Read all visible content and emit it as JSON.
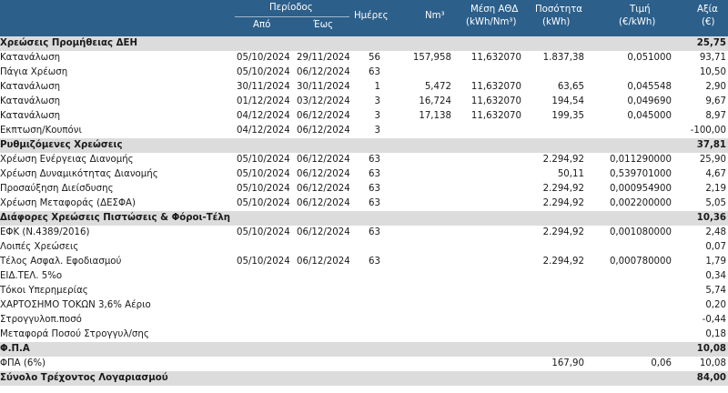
{
  "header": {
    "period": "Περίοδος",
    "from": "Από",
    "to": "Έως",
    "days": "Ημέρες",
    "nm3": "Nm³",
    "pcs_line1": "Μέση ΑΘΔ",
    "pcs_line2": "(kWh/Nm³)",
    "qty_line1": "Ποσότητα",
    "qty_line2": "(kWh)",
    "price_line1": "Τιμή",
    "price_line2": "(€/kWh)",
    "value": "Αξία",
    "value_line2": "(€)"
  },
  "rows": [
    {
      "type": "section",
      "desc": "Χρεώσεις Προμήθειας ΔΕΗ",
      "value": "25,75"
    },
    {
      "type": "item",
      "desc": "Κατανάλωση",
      "from": "05/10/2024",
      "to": "29/11/2024",
      "days": "56",
      "nm3": "157,958",
      "pcs": "11,632070",
      "qty": "1.837,38",
      "price": "0,051000",
      "value": "93,71"
    },
    {
      "type": "item",
      "desc": "Πάγια Χρέωση",
      "from": "05/10/2024",
      "to": "06/12/2024",
      "days": "63",
      "nm3": "",
      "pcs": "",
      "qty": "",
      "price": "",
      "value": "10,50"
    },
    {
      "type": "item",
      "desc": "Κατανάλωση",
      "from": "30/11/2024",
      "to": "30/11/2024",
      "days": "1",
      "nm3": "5,472",
      "pcs": "11,632070",
      "qty": "63,65",
      "price": "0,045548",
      "value": "2,90"
    },
    {
      "type": "item",
      "desc": "Κατανάλωση",
      "from": "01/12/2024",
      "to": "03/12/2024",
      "days": "3",
      "nm3": "16,724",
      "pcs": "11,632070",
      "qty": "194,54",
      "price": "0,049690",
      "value": "9,67"
    },
    {
      "type": "item",
      "desc": "Κατανάλωση",
      "from": "04/12/2024",
      "to": "06/12/2024",
      "days": "3",
      "nm3": "17,138",
      "pcs": "11,632070",
      "qty": "199,35",
      "price": "0,045000",
      "value": "8,97"
    },
    {
      "type": "item",
      "desc": "Εκπτωση/Κουπόνι",
      "from": "04/12/2024",
      "to": "06/12/2024",
      "days": "3",
      "nm3": "",
      "pcs": "",
      "qty": "",
      "price": "",
      "value": "-100,00"
    },
    {
      "type": "section",
      "desc": "Ρυθμιζόμενες Χρεώσεις",
      "value": "37,81"
    },
    {
      "type": "item",
      "desc": "Χρέωση Ενέργειας Διανομής",
      "from": "05/10/2024",
      "to": "06/12/2024",
      "days": "63",
      "nm3": "",
      "pcs": "",
      "qty": "2.294,92",
      "price": "0,011290000",
      "value": "25,90"
    },
    {
      "type": "item",
      "desc": "Χρέωση Δυναμικότητας Διανομής",
      "from": "05/10/2024",
      "to": "06/12/2024",
      "days": "63",
      "nm3": "",
      "pcs": "",
      "qty": "50,11",
      "price": "0,539701000",
      "value": "4,67"
    },
    {
      "type": "item",
      "desc": "Προσαύξηση Διείσδυσης",
      "from": "05/10/2024",
      "to": "06/12/2024",
      "days": "63",
      "nm3": "",
      "pcs": "",
      "qty": "2.294,92",
      "price": "0,000954900",
      "value": "2,19"
    },
    {
      "type": "item",
      "desc": "Χρέωση Μεταφοράς (ΔΕΣΦΑ)",
      "from": "05/10/2024",
      "to": "06/12/2024",
      "days": "63",
      "nm3": "",
      "pcs": "",
      "qty": "2.294,92",
      "price": "0,002200000",
      "value": "5,05"
    },
    {
      "type": "section",
      "desc": "Διάφορες Χρεώσεις Πιστώσεις & Φόροι-Τέλη",
      "value": "10,36"
    },
    {
      "type": "item",
      "desc": "ΕΦΚ (Ν.4389/2016)",
      "from": "05/10/2024",
      "to": "06/12/2024",
      "days": "63",
      "nm3": "",
      "pcs": "",
      "qty": "2.294,92",
      "price": "0,001080000",
      "value": "2,48"
    },
    {
      "type": "item",
      "desc": "Λοιπές Χρεώσεις",
      "from": "",
      "to": "",
      "days": "",
      "nm3": "",
      "pcs": "",
      "qty": "",
      "price": "",
      "value": "0,07"
    },
    {
      "type": "item",
      "desc": "Τέλος Ασφαλ. Εφοδιασμού",
      "from": "05/10/2024",
      "to": "06/12/2024",
      "days": "63",
      "nm3": "",
      "pcs": "",
      "qty": "2.294,92",
      "price": "0,000780000",
      "value": "1,79"
    },
    {
      "type": "item",
      "desc": "ΕΙΔ.ΤΕΛ. 5%ο",
      "from": "",
      "to": "",
      "days": "",
      "nm3": "",
      "pcs": "",
      "qty": "",
      "price": "",
      "value": "0,34"
    },
    {
      "type": "item",
      "desc": "Τόκοι Υπερημερίας",
      "from": "",
      "to": "",
      "days": "",
      "nm3": "",
      "pcs": "",
      "qty": "",
      "price": "",
      "value": "5,74"
    },
    {
      "type": "item",
      "desc": "ΧΑΡΤΟΣΗΜΟ ΤΟΚΩΝ 3,6% Αέριο",
      "from": "",
      "to": "",
      "days": "",
      "nm3": "",
      "pcs": "",
      "qty": "",
      "price": "",
      "value": "0,20"
    },
    {
      "type": "item",
      "desc": "Στρογγυλοπ.ποσό",
      "from": "",
      "to": "",
      "days": "",
      "nm3": "",
      "pcs": "",
      "qty": "",
      "price": "",
      "value": "-0,44"
    },
    {
      "type": "item",
      "desc": "Μεταφορά Ποσού Στρογγυλ/σης",
      "from": "",
      "to": "",
      "days": "",
      "nm3": "",
      "pcs": "",
      "qty": "",
      "price": "",
      "value": "0,18"
    },
    {
      "type": "section",
      "desc": "Φ.Π.Α",
      "value": "10,08"
    },
    {
      "type": "item",
      "desc": "ΦΠΑ (6%)",
      "from": "",
      "to": "",
      "days": "",
      "nm3": "",
      "pcs": "",
      "qty": "167,90",
      "price": "0,06",
      "value": "10,08"
    },
    {
      "type": "total",
      "desc": "Σύνολο Τρέχοντος Λογαριασμού",
      "value": "84,00"
    }
  ]
}
